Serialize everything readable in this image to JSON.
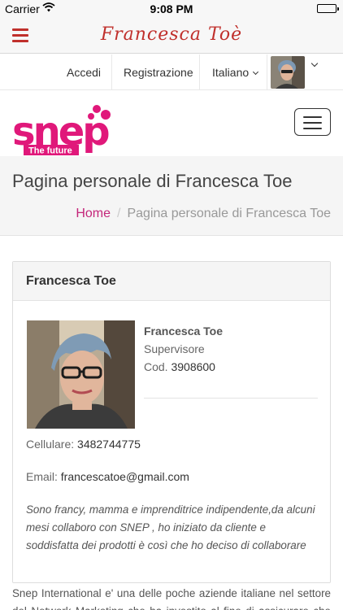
{
  "status_bar": {
    "carrier": "Carrier",
    "time": "9:08 PM"
  },
  "app_bar": {
    "title": "Francesca  Toè",
    "accent_color": "#c0302c"
  },
  "top_links": {
    "login": "Accedi",
    "register": "Registrazione",
    "language": "Italiano"
  },
  "logo": {
    "brand": "snep",
    "tagline": "The future",
    "brand_color": "#e0187a"
  },
  "page": {
    "title": "Pagina personale di Francesca Toe",
    "breadcrumb": {
      "home": "Home",
      "current": "Pagina personale di Francesca Toe"
    }
  },
  "profile": {
    "header": "Francesca Toe",
    "name": "Francesca Toe",
    "role": "Supervisore",
    "code_label": "Cod.",
    "code": "3908600",
    "phone_label": "Cellulare:",
    "phone": "3482744775",
    "email_label": "Email:",
    "email": "francescatoe@gmail.com",
    "bio": "Sono francy, mamma e imprenditrice indipendente,da alcuni mesi collaboro con SNEP , ho iniziato da cliente e soddisfatta dei prodotti è così che ho deciso di collaborare"
  },
  "about": {
    "text": "Snep International e' una delle poche aziende italiane nel settore del Network Marketing che ha investito al fine di assicurare che tutti i"
  }
}
